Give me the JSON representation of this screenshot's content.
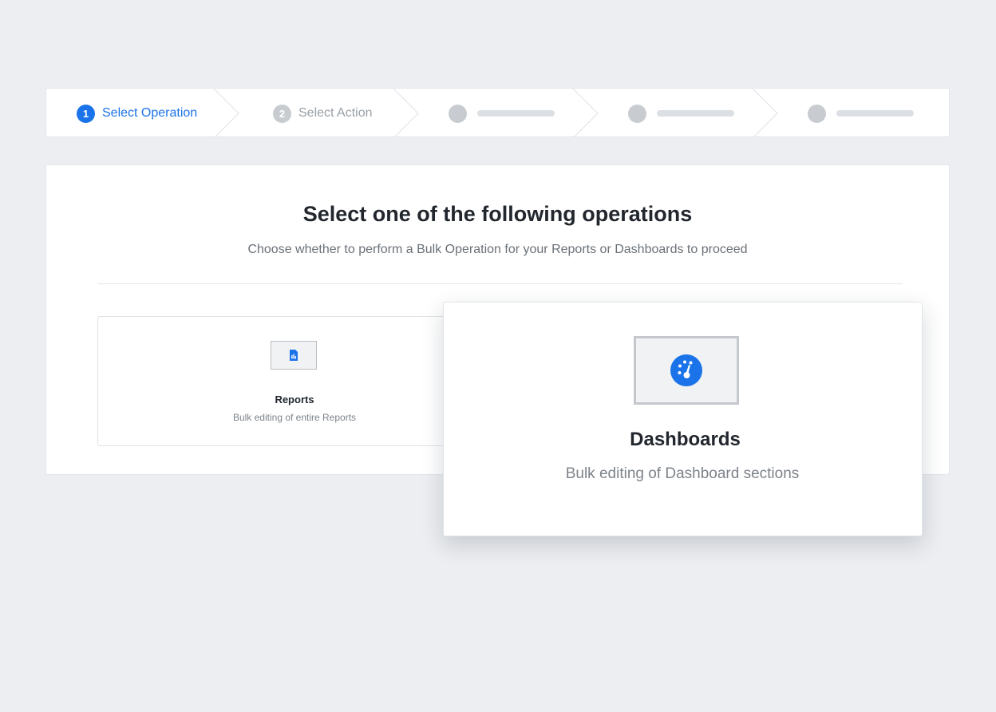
{
  "stepper": {
    "steps": [
      {
        "number": "1",
        "label": "Select Operation",
        "state": "active"
      },
      {
        "number": "2",
        "label": "Select Action",
        "state": "inactive"
      },
      {
        "number": "",
        "label": "",
        "state": "placeholder"
      },
      {
        "number": "",
        "label": "",
        "state": "placeholder"
      },
      {
        "number": "",
        "label": "",
        "state": "placeholder"
      }
    ]
  },
  "main": {
    "title": "Select one of the following operations",
    "subtitle": "Choose whether to perform a Bulk Operation for your Reports or Dashboards to proceed"
  },
  "options": {
    "reports": {
      "title": "Reports",
      "description": "Bulk editing of entire Reports",
      "icon": "report-file-icon"
    },
    "dashboards": {
      "title": "Dashboards",
      "description": "Bulk editing of Dashboard sections",
      "icon": "gauge-icon"
    }
  },
  "colors": {
    "accent": "#1a73e8",
    "background": "#eceef1",
    "inactive": "#c8ccd1"
  }
}
